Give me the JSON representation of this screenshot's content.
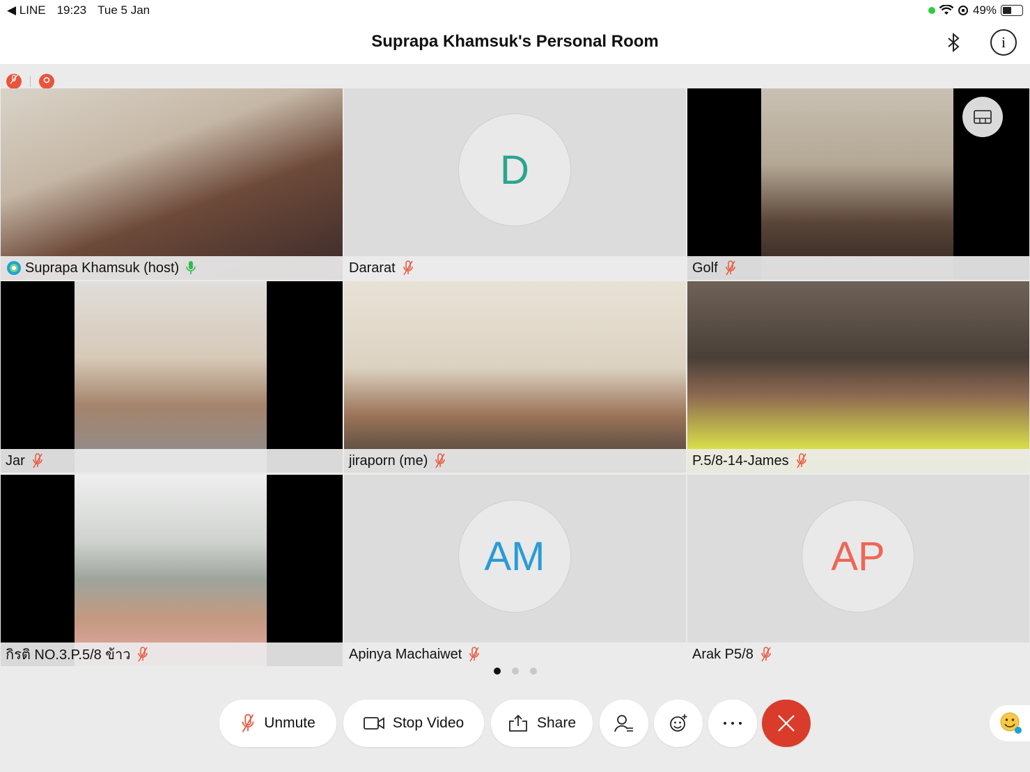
{
  "status": {
    "back_app": "◀ LINE",
    "time": "19:23",
    "date": "Tue 5 Jan",
    "battery": "49%"
  },
  "header": {
    "title": "Suprapa Khamsuk's Personal Room"
  },
  "participants": [
    {
      "name": "Suprapa Khamsuk (host)",
      "type": "video",
      "mic": "on",
      "active": true
    },
    {
      "name": "Dararat",
      "type": "avatar",
      "initials": "D",
      "color": "#2aa58e",
      "mic": "off"
    },
    {
      "name": "Golf",
      "type": "video",
      "mic": "off"
    },
    {
      "name": "Jar",
      "type": "video",
      "mic": "off"
    },
    {
      "name": "jiraporn (me)",
      "type": "video",
      "mic": "off"
    },
    {
      "name": "P.5/8-14-James",
      "type": "video",
      "mic": "off"
    },
    {
      "name": "กิรติ NO.3.P.5/8 ข้าว",
      "type": "video",
      "mic": "off"
    },
    {
      "name": "Apinya Machaiwet",
      "type": "avatar",
      "initials": "AM",
      "color": "#2a9bd6",
      "mic": "off"
    },
    {
      "name": "Arak P5/8",
      "type": "avatar",
      "initials": "AP",
      "color": "#ee6656",
      "mic": "off"
    }
  ],
  "pagination": {
    "current": 1,
    "total": 3
  },
  "controls": {
    "unmute": "Unmute",
    "stop_video": "Stop Video",
    "share": "Share"
  },
  "colors": {
    "accent": "#1b7fc4",
    "mute_red": "#e8553c",
    "end_red": "#d93c2b",
    "mic_green": "#2ebd4e"
  }
}
